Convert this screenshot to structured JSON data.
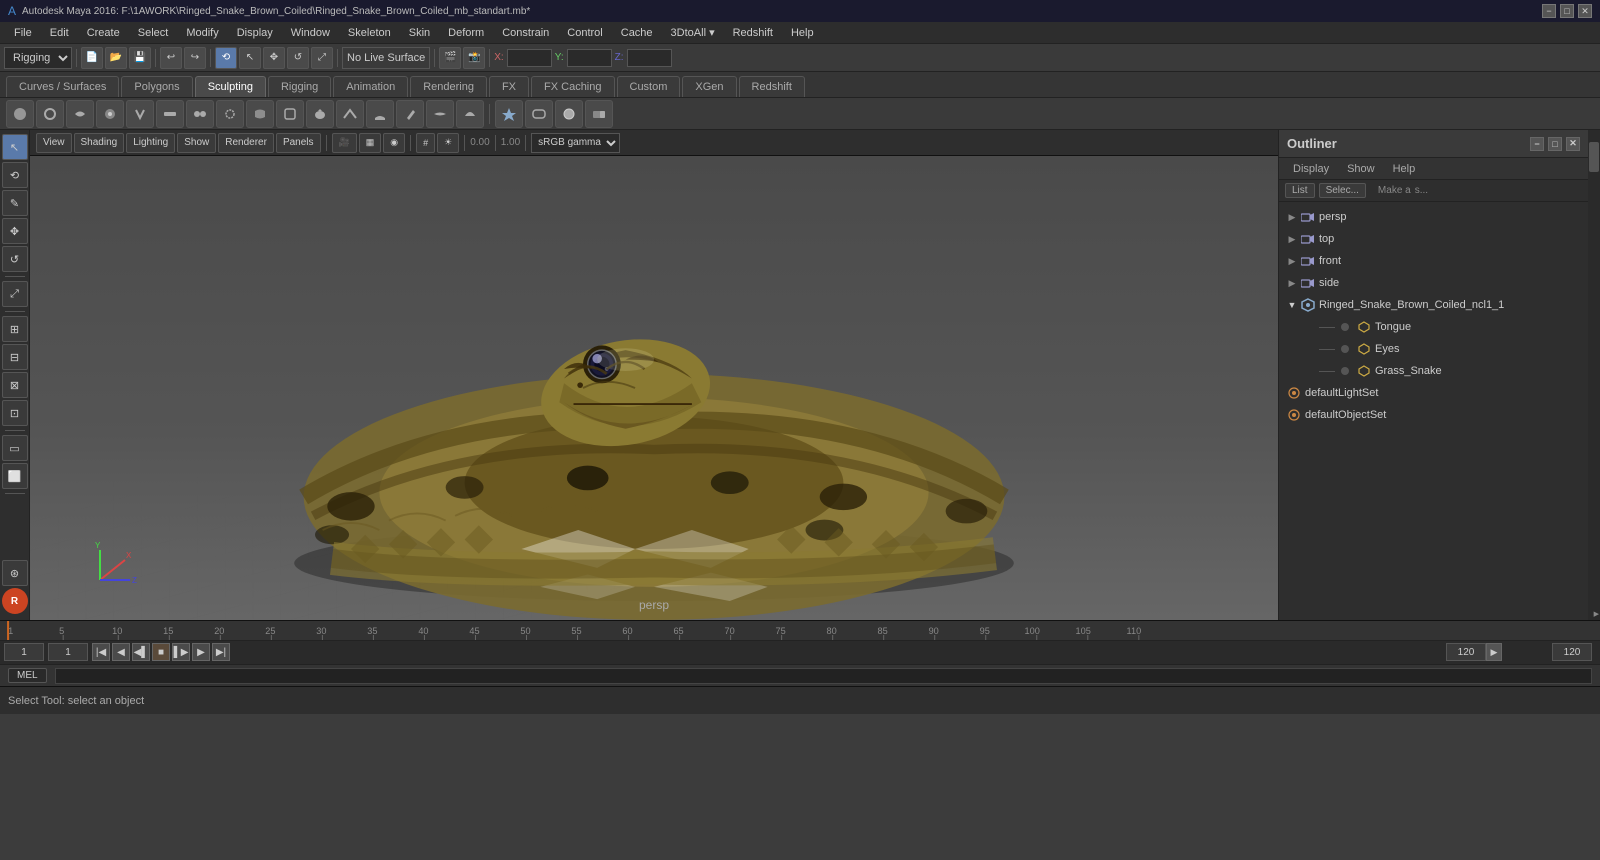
{
  "titlebar": {
    "title": "Autodesk Maya 2016: F:\\1AWORK\\Ringed_Snake_Brown_Coiled\\Ringed_Snake_Brown_Coiled_mb_standart.mb*",
    "min": "−",
    "max": "□",
    "close": "✕"
  },
  "menubar": {
    "items": [
      "File",
      "Edit",
      "Create",
      "Select",
      "Modify",
      "Display",
      "Window",
      "Skeleton",
      "Skin",
      "Deform",
      "Constrain",
      "Control",
      "Cache",
      "3DtoAll ▾",
      "Redshift",
      "Help"
    ]
  },
  "toolbar1": {
    "mode": "Rigging",
    "no_live_surface": "No Live Surface",
    "x_label": "X:",
    "y_label": "Y:",
    "z_label": "Z:"
  },
  "tabs": {
    "items": [
      "Curves / Surfaces",
      "Polygons",
      "Sculpting",
      "Rigging",
      "Animation",
      "Rendering",
      "FX",
      "FX Caching",
      "Custom",
      "XGen",
      "Redshift"
    ],
    "active": "Sculpting"
  },
  "viewport": {
    "menu": [
      "View",
      "Shading",
      "Lighting",
      "Show",
      "Renderer",
      "Panels"
    ],
    "label": "persp",
    "color_space": "sRGB gamma"
  },
  "outliner": {
    "title": "Outliner",
    "menu": [
      "Display",
      "Show",
      "Help"
    ],
    "secondary": [
      "List",
      "Select"
    ],
    "make_a_label": "Make a",
    "tree": [
      {
        "id": "persp",
        "type": "camera",
        "label": "persp",
        "indent": 0
      },
      {
        "id": "top",
        "type": "camera",
        "label": "top",
        "indent": 0
      },
      {
        "id": "front",
        "type": "camera",
        "label": "front",
        "indent": 0
      },
      {
        "id": "side",
        "type": "camera",
        "label": "side",
        "indent": 0
      },
      {
        "id": "ringed_snake",
        "type": "group",
        "label": "Ringed_Snake_Brown_Coiled_ncl1_1",
        "indent": 0
      },
      {
        "id": "tongue",
        "type": "mesh",
        "label": "Tongue",
        "indent": 1
      },
      {
        "id": "eyes",
        "type": "mesh",
        "label": "Eyes",
        "indent": 1
      },
      {
        "id": "grass_snake",
        "type": "mesh",
        "label": "Grass_Snake",
        "indent": 1
      },
      {
        "id": "default_light_set",
        "type": "set",
        "label": "defaultLightSet",
        "indent": 0
      },
      {
        "id": "default_object_set",
        "type": "set",
        "label": "defaultObjectSet",
        "indent": 0
      }
    ]
  },
  "timeline": {
    "start_frame": "1",
    "current_frame": "1",
    "end_frame": "120",
    "range_end": "120",
    "markers": [
      "1",
      "5",
      "10",
      "15",
      "20",
      "25",
      "30",
      "35",
      "40",
      "45",
      "50",
      "55",
      "60",
      "65",
      "70",
      "75",
      "80",
      "85",
      "90",
      "95",
      "100",
      "105",
      "110"
    ]
  },
  "status_bar": {
    "tool_label": "Select Tool: select an object"
  },
  "script_bar": {
    "tab": "MEL"
  },
  "sculpt_tools": [
    "⊕",
    "◉",
    "◑",
    "◎",
    "⊘",
    "●",
    "⬤",
    "◐",
    "○",
    "◒",
    "▲",
    "◆",
    "◊",
    "△",
    "▽",
    "▷",
    "◁",
    "▸",
    "◂",
    "◈",
    "⬡",
    "⬢",
    "❋",
    "✦"
  ],
  "left_tools": [
    "↖",
    "⟲",
    "↺",
    "⤢",
    "✥",
    "▭",
    "⬜",
    "⊞",
    "⊟",
    "⊠",
    "⊡",
    "⬛",
    "◧",
    "⊛"
  ],
  "icons": {
    "camera": "📷",
    "mesh": "⬡",
    "group": "✳",
    "set": "◉",
    "expand": "▶",
    "collapse": "▼",
    "dash": "—"
  }
}
